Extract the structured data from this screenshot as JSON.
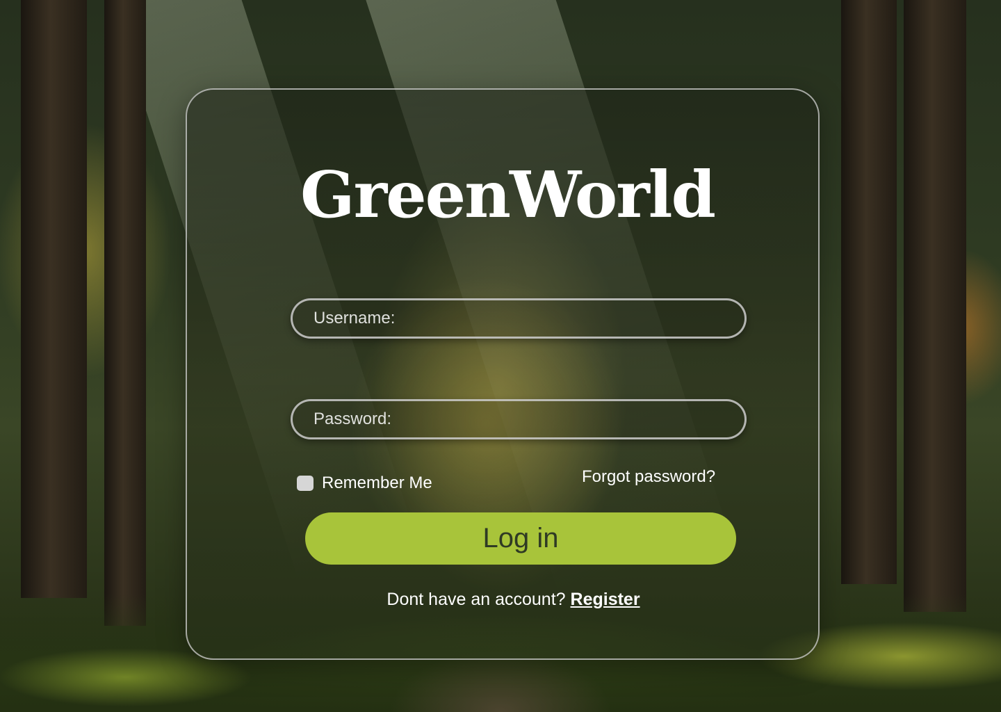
{
  "app": {
    "brand_name": "GreenWorld"
  },
  "form": {
    "username": {
      "placeholder": "Username:",
      "value": ""
    },
    "password": {
      "placeholder": "Password:",
      "value": ""
    },
    "remember_me": {
      "label": "Remember Me",
      "checked": false
    },
    "forgot_password_label": "Forgot password?",
    "login_label": "Log in",
    "register_prompt": "Dont have an account?",
    "register_label": "Register"
  },
  "colors": {
    "login_button": "#a8c43a",
    "login_text": "#2f3a24",
    "text": "#ffffff",
    "card_border": "#d2d2d2"
  }
}
